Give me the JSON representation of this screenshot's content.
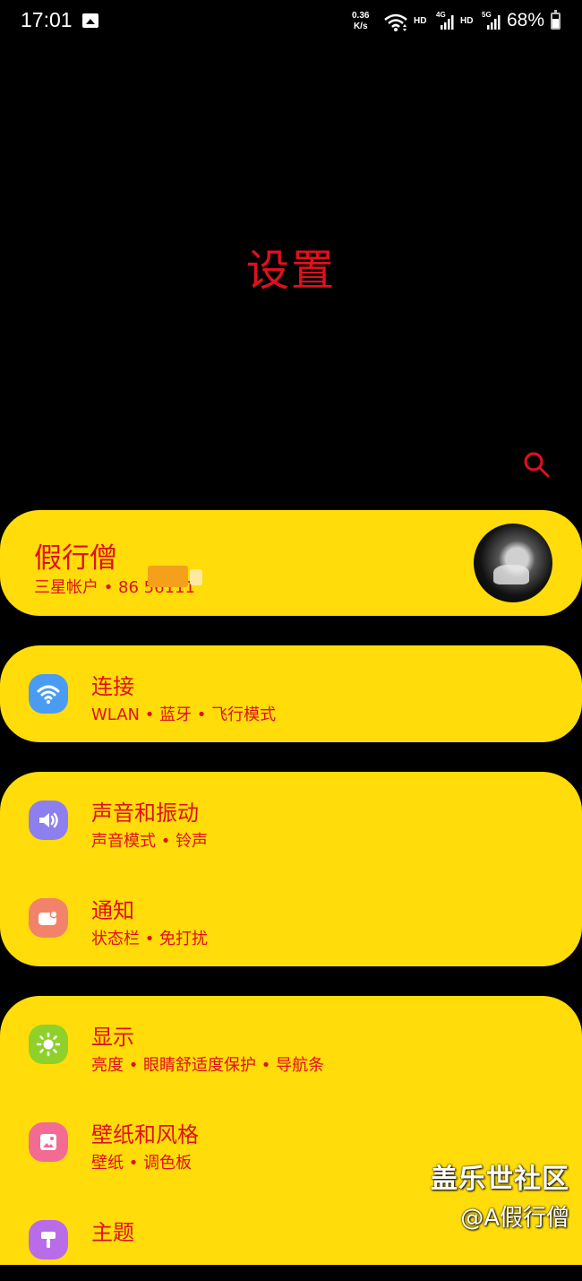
{
  "status_bar": {
    "time": "17:01",
    "speed_value": "0.36",
    "speed_unit": "K/s",
    "hd1": "HD",
    "net1": "4G",
    "hd2": "HD",
    "net2": "5G",
    "battery": "68%"
  },
  "page": {
    "title": "设置"
  },
  "account": {
    "name": "假行僧",
    "subtitle": "三星帐户 • 86        56111"
  },
  "groups": [
    {
      "items": [
        {
          "label": "连接",
          "sub": "WLAN • 蓝牙 • 飞行模式",
          "icon": "wifi-icon",
          "color": "#4a9cf2"
        }
      ]
    },
    {
      "items": [
        {
          "label": "声音和振动",
          "sub": "声音模式 • 铃声",
          "icon": "volume-icon",
          "color": "#8d7ff0"
        },
        {
          "label": "通知",
          "sub": "状态栏 • 免打扰",
          "icon": "notification-icon",
          "color": "#f2836a"
        }
      ]
    },
    {
      "items": [
        {
          "label": "显示",
          "sub": "亮度 • 眼睛舒适度保护 • 导航条",
          "icon": "brightness-icon",
          "color": "#8fd12a"
        },
        {
          "label": "壁纸和风格",
          "sub": "壁纸 • 调色板",
          "icon": "wallpaper-icon",
          "color": "#f36b93"
        },
        {
          "label": "主题",
          "sub": "",
          "icon": "theme-brush-icon",
          "color": "#b86ce8"
        }
      ]
    }
  ],
  "watermark": {
    "line1": "盖乐世社区",
    "line2": "@A假行僧"
  },
  "colors": {
    "background": "#000000",
    "card": "#ffdc0a",
    "accent_text": "#e0101c"
  }
}
